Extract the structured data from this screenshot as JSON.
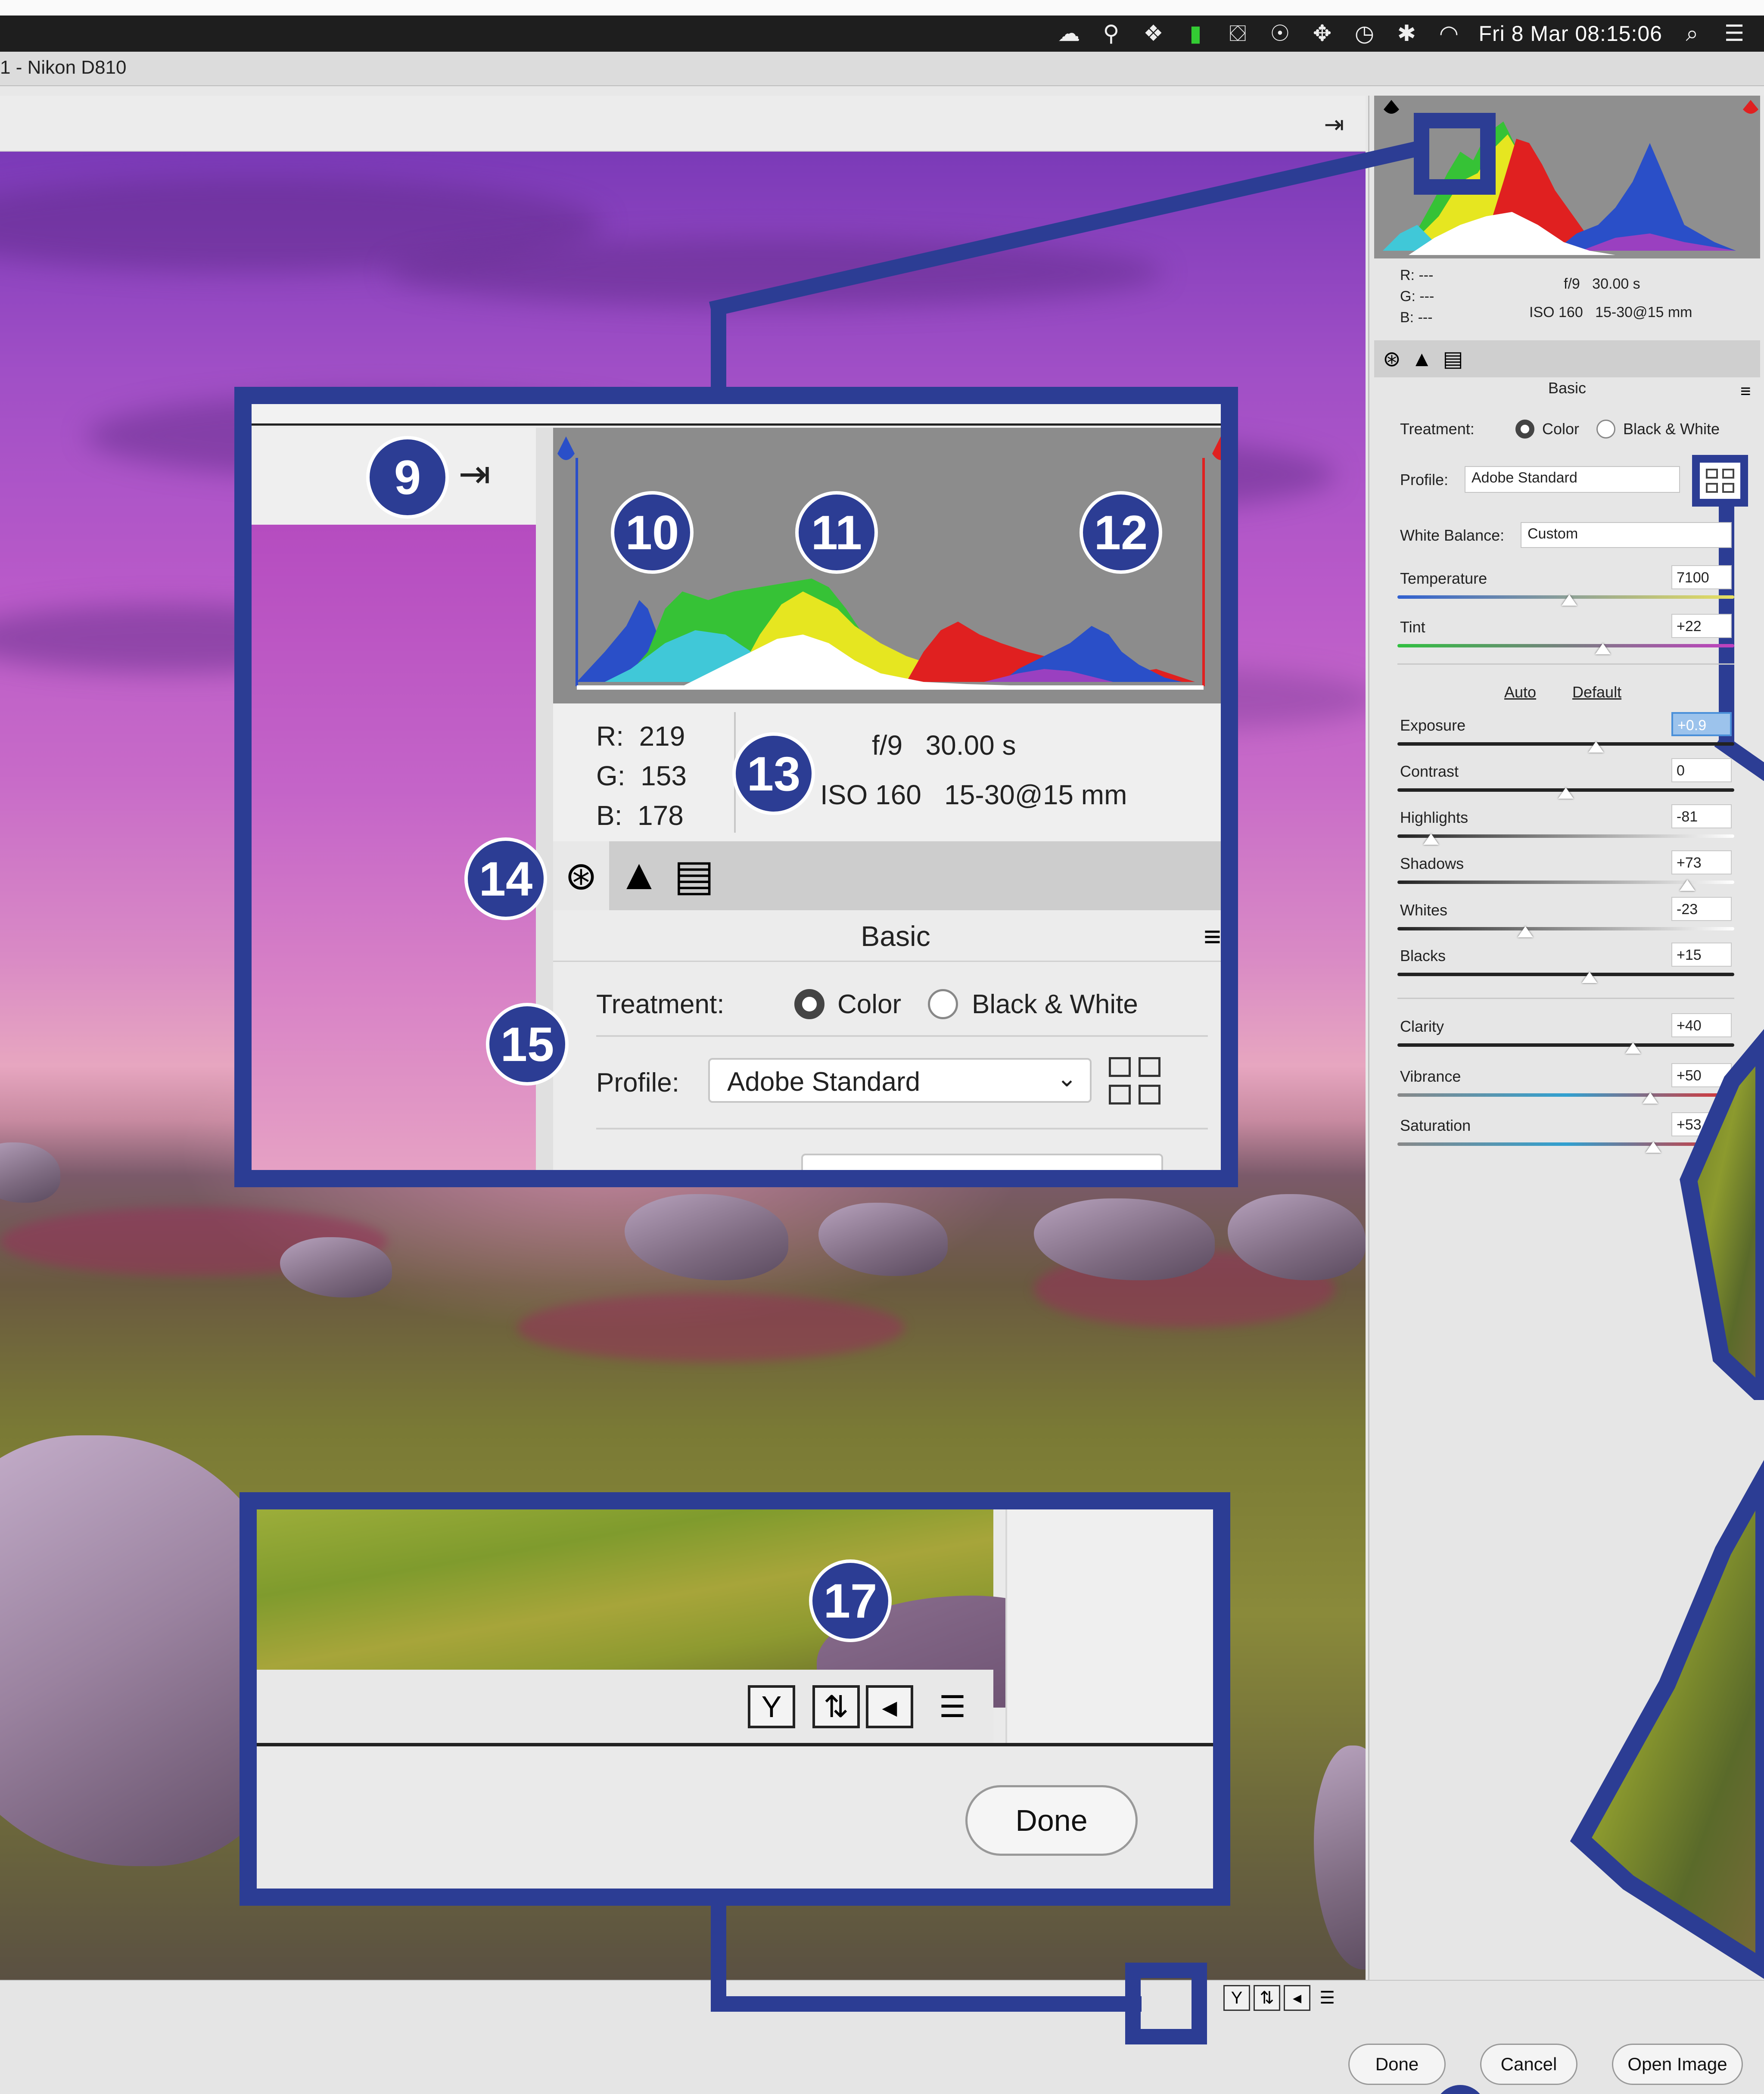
{
  "menubar": {
    "clock": "Fri 8 Mar  08:15:06",
    "icons": [
      "cloud-sync-icon",
      "bell-icon",
      "dropbox-icon",
      "battery-icon",
      "presentation-icon",
      "accessibility-icon",
      "dots-icon",
      "time-machine-icon",
      "bluetooth-icon",
      "wifi-icon",
      "search-icon",
      "list-icon"
    ]
  },
  "window": {
    "title": "1 - Nikon D810"
  },
  "panel": {
    "rgb": {
      "r_label": "R:",
      "g_label": "G:",
      "b_label": "B:",
      "r": "---",
      "g": "---",
      "b": "---"
    },
    "exposure_info": {
      "aperture": "f/9",
      "shutter": "30.00 s",
      "iso": "ISO 160",
      "lens": "15-30@15 mm"
    },
    "section_title": "Basic",
    "treatment_label": "Treatment:",
    "treatment_color": "Color",
    "treatment_bw": "Black & White",
    "profile_label": "Profile:",
    "profile_value": "Adobe Standard",
    "wb_label": "White Balance:",
    "wb_value": "Custom",
    "auto": "Auto",
    "default": "Default",
    "sliders": [
      {
        "label": "Temperature",
        "value": "7100",
        "pos": 0.51
      },
      {
        "label": "Tint",
        "value": "+22",
        "pos": 0.61
      },
      {
        "label": "Exposure",
        "value": "+0.9",
        "pos": 0.59
      },
      {
        "label": "Contrast",
        "value": "0",
        "pos": 0.5
      },
      {
        "label": "Highlights",
        "value": "-81",
        "pos": 0.1
      },
      {
        "label": "Shadows",
        "value": "+73",
        "pos": 0.86
      },
      {
        "label": "Whites",
        "value": "-23",
        "pos": 0.38
      },
      {
        "label": "Blacks",
        "value": "+15",
        "pos": 0.57
      },
      {
        "label": "Clarity",
        "value": "+40",
        "pos": 0.7
      },
      {
        "label": "Vibrance",
        "value": "+50",
        "pos": 0.75
      },
      {
        "label": "Saturation",
        "value": "+53",
        "pos": 0.76
      }
    ]
  },
  "zoom_top": {
    "rgb": {
      "r_label": "R:",
      "g_label": "G:",
      "b_label": "B:",
      "r": "219",
      "g": "153",
      "b": "178"
    },
    "aperture": "f/9",
    "shutter": "30.00 s",
    "iso": "ISO 160",
    "lens": "15-30@15 mm",
    "section_title": "Basic",
    "treatment_label": "Treatment:",
    "treatment_color": "Color",
    "treatment_bw": "Black & White",
    "profile_label": "Profile:",
    "profile_value": "Adobe Standard"
  },
  "zoom_bottom": {
    "done": "Done"
  },
  "badges": {
    "b9": "9",
    "b10": "10",
    "b11": "11",
    "b12": "12",
    "b13": "13",
    "b14": "14",
    "b15": "15",
    "b17": "17"
  },
  "buttons": {
    "done": "Done",
    "cancel": "Cancel",
    "open_image": "Open Image"
  },
  "colors": {
    "callout": "#2c3d94",
    "hist_red": "#e02020",
    "hist_yellow": "#e6e620",
    "hist_green": "#36c236",
    "hist_cyan": "#40c8d8",
    "hist_blue": "#2a4fc8",
    "hist_magenta": "#9a40c0"
  }
}
